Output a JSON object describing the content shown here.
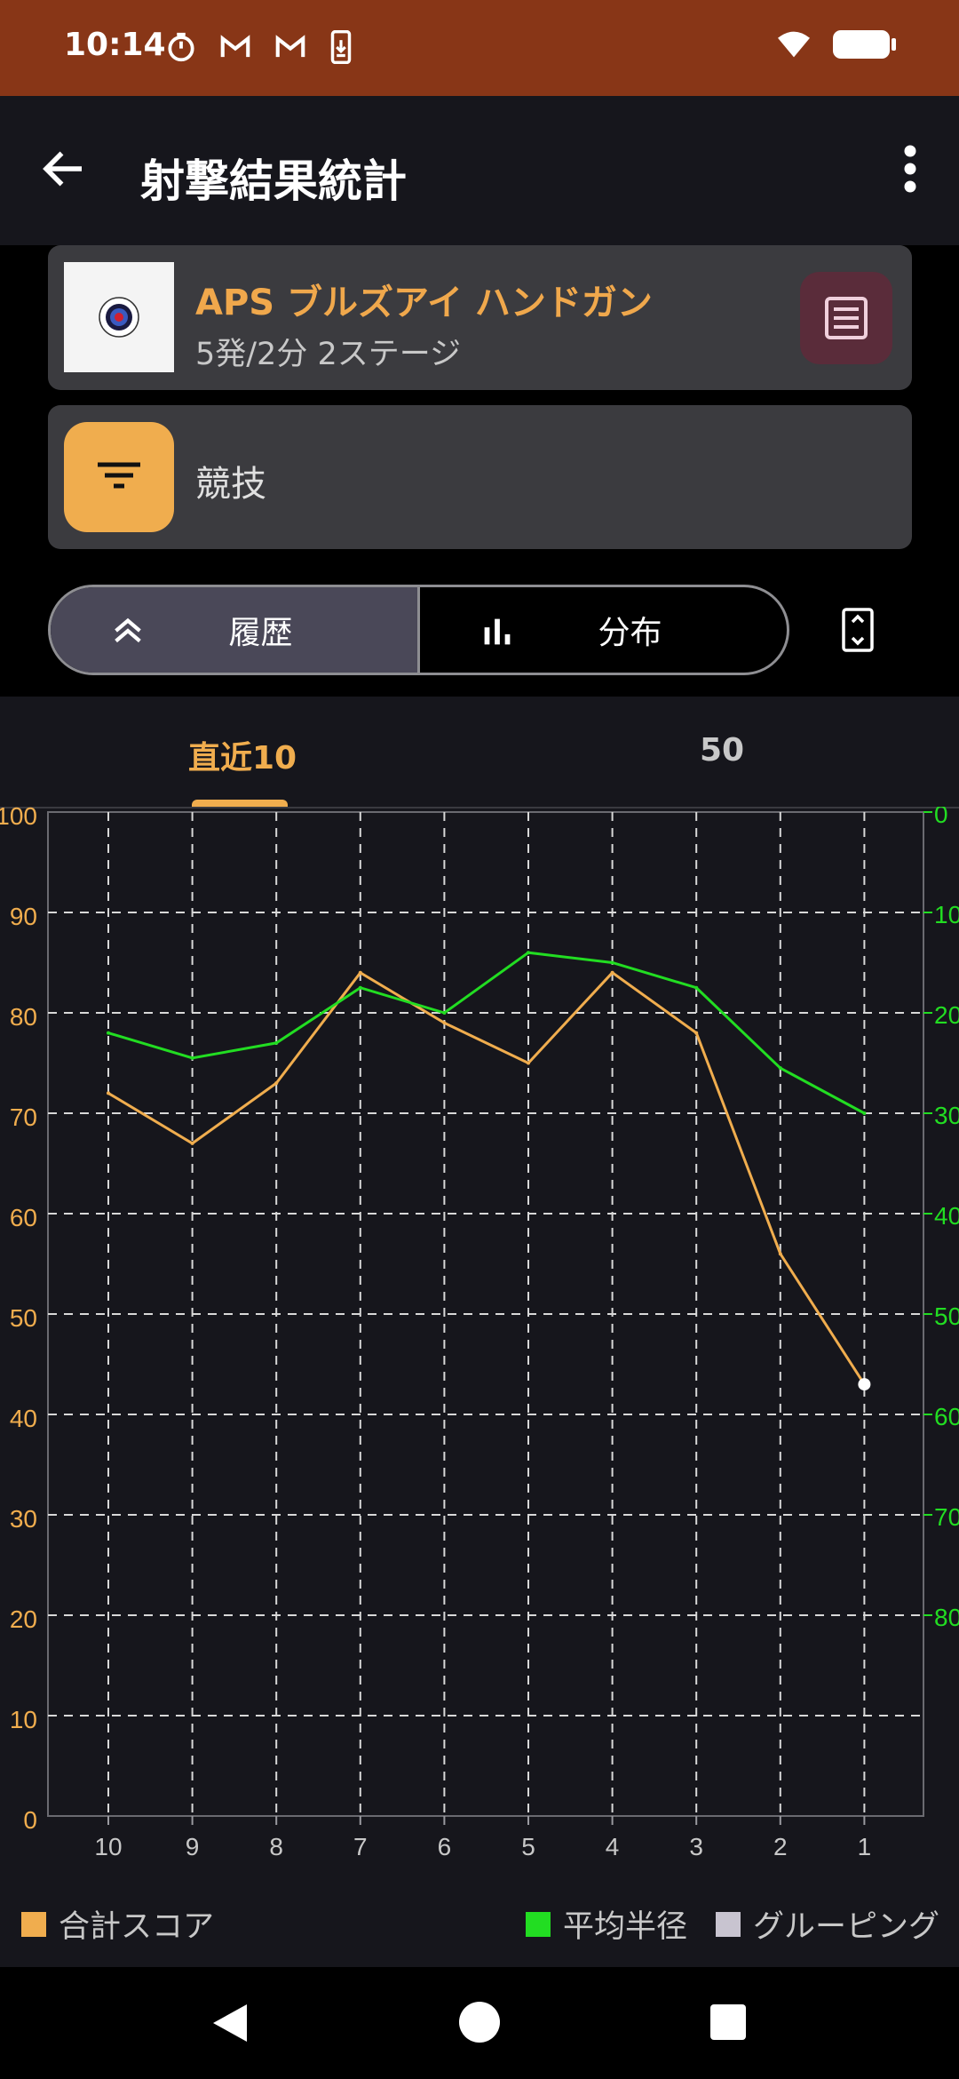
{
  "status": {
    "time": "10:14"
  },
  "header": {
    "title": "射撃結果統計"
  },
  "target_card": {
    "title": "APS ブルズアイ ハンドガン",
    "subtitle": "5発/2分 2ステージ"
  },
  "filter_card": {
    "label": "競技"
  },
  "view_toggle": {
    "history_label": "履歴",
    "distribution_label": "分布",
    "selected": "history"
  },
  "range_tabs": {
    "tab1": "直近10",
    "tab2": "50",
    "selected": "tab1"
  },
  "colors": {
    "score": "#f0ad4e",
    "radius": "#22dd22",
    "grouping": "#c8c4d0",
    "header": "#883617"
  },
  "chart_data": {
    "type": "line",
    "x": [
      "10",
      "9",
      "8",
      "7",
      "6",
      "5",
      "4",
      "3",
      "2",
      "1"
    ],
    "left_ticks": [
      "100",
      "90",
      "80",
      "70",
      "60",
      "50",
      "40",
      "30",
      "20",
      "10",
      "0"
    ],
    "right_ticks": [
      "0",
      "10",
      "20",
      "30",
      "40",
      "50",
      "60",
      "70",
      "80"
    ],
    "left_ylim": [
      0,
      100
    ],
    "right_ylim": [
      0,
      100
    ],
    "right_inverted": true,
    "grid": true,
    "series": [
      {
        "name": "合計スコア",
        "axis": "left",
        "values": [
          72,
          67,
          73,
          84,
          79,
          75,
          84,
          78,
          56,
          43
        ]
      },
      {
        "name": "平均半径",
        "axis": "right",
        "values": [
          22,
          24.5,
          23,
          17.5,
          20,
          14,
          15,
          17.5,
          25.5,
          30
        ]
      },
      {
        "name": "グルーピング",
        "axis": "right",
        "values": []
      }
    ],
    "legend": [
      "合計スコア",
      "平均半径",
      "グルーピング"
    ]
  }
}
